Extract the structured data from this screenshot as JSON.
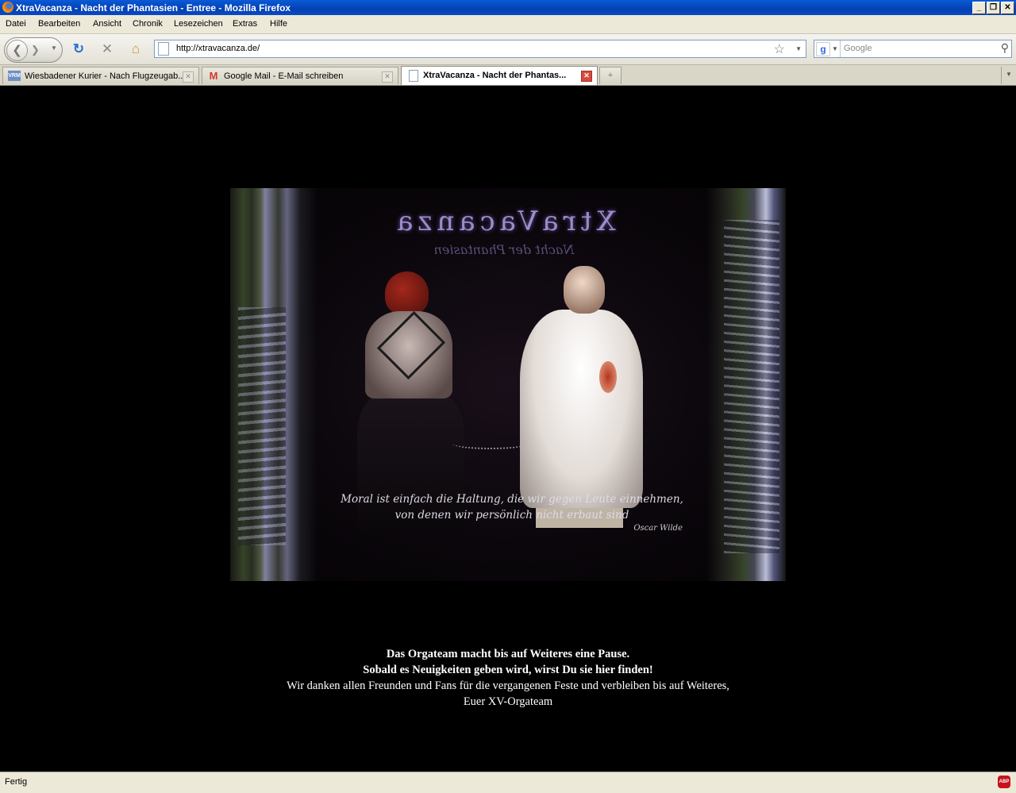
{
  "window": {
    "title": "XtraVacanza - Nacht der Phantasien - Entree - Mozilla Firefox",
    "controls": {
      "minimize": "_",
      "restore": "❐",
      "close": "✕"
    }
  },
  "menu": [
    "Datei",
    "Bearbeiten",
    "Ansicht",
    "Chronik",
    "Lesezeichen",
    "Extras",
    "Hilfe"
  ],
  "toolbar": {
    "url": "http://xtravacanza.de/",
    "search_placeholder": "Google",
    "icons": {
      "back": "back-arrow-icon",
      "forward": "forward-arrow-icon",
      "reload": "reload-icon",
      "stop": "stop-icon",
      "home": "home-icon",
      "bookmark": "star-icon",
      "search": "magnifier-icon"
    }
  },
  "tabs": [
    {
      "label": "Wiesbadener Kurier - Nach Flugzeugab...",
      "favicon": "vrm",
      "active": false
    },
    {
      "label": "Google Mail - E-Mail schreiben",
      "favicon": "gmail-m",
      "active": false
    },
    {
      "label": "XtraVacanza - Nacht der Phantas...",
      "favicon": "page",
      "active": true
    }
  ],
  "page": {
    "banner": {
      "logo": "XtraVacanza",
      "logo_subtitle": "Nacht der Phantasien",
      "quote_line1": "Moral ist einfach die Haltung, die wir gegen Leute einnehmen,",
      "quote_line2": "von denen wir persönlich nicht erbaut sind",
      "quote_author": "Oscar Wilde"
    },
    "message": {
      "line1": "Das Orgateam macht bis auf Weiteres eine Pause.",
      "line2": "Sobald es Neuigkeiten geben wird, wirst Du sie hier finden!",
      "line3": "Wir danken allen Freunden und Fans für die vergangenen Feste und verbleiben bis auf Weiteres,",
      "line4": "Euer XV-Orgateam"
    }
  },
  "status": {
    "text": "Fertig",
    "addon_badge": "ABP"
  },
  "colors": {
    "titlebar": "#0441b3",
    "chrome": "#ece9d8",
    "page_background": "#000000",
    "text": "#ffffff"
  }
}
